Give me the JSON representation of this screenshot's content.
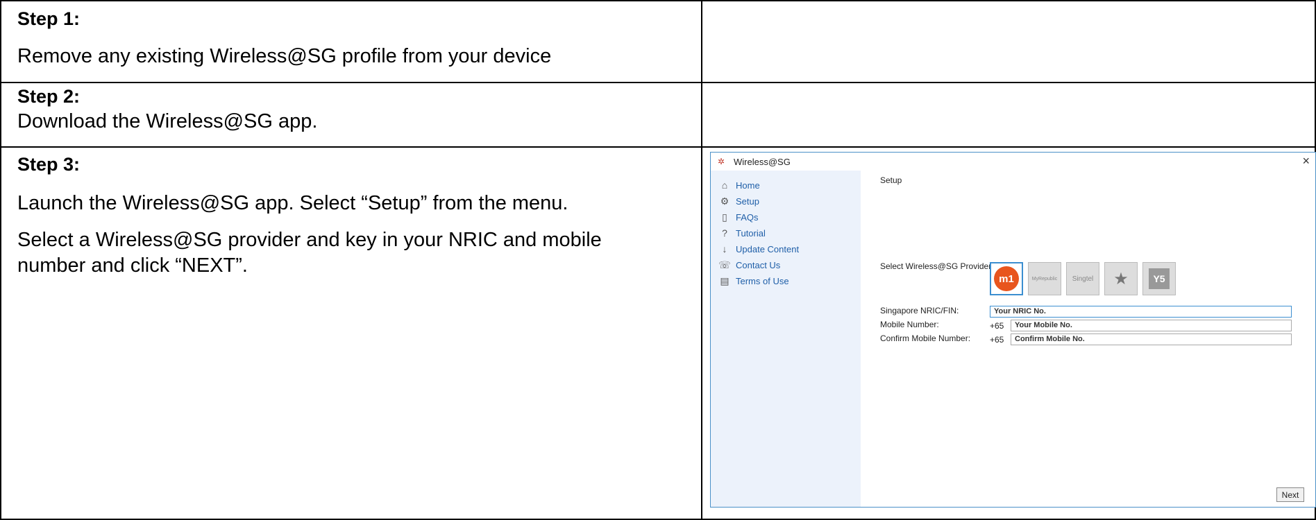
{
  "steps": [
    {
      "title": "Step 1:",
      "lines": [
        "Remove any existing Wireless@SG profile from your device"
      ]
    },
    {
      "title": "Step 2:",
      "lines": [
        "Download the Wireless@SG app."
      ]
    },
    {
      "title": "Step 3:",
      "lines": [
        "Launch the Wireless@SG app. Select “Setup” from the menu.",
        "Select a Wireless@SG provider and key in your NRIC and mobile",
        "number and click “NEXT”."
      ]
    }
  ],
  "app": {
    "window_title": "Wireless@SG",
    "close_glyph": "×",
    "nav": [
      {
        "label": "Home",
        "icon": "home-icon",
        "glyph": "⌂"
      },
      {
        "label": "Setup",
        "icon": "setup-icon",
        "glyph": "⚙"
      },
      {
        "label": "FAQs",
        "icon": "faqs-icon",
        "glyph": "▯"
      },
      {
        "label": "Tutorial",
        "icon": "tutorial-icon",
        "glyph": "?"
      },
      {
        "label": "Update Content",
        "icon": "update-icon",
        "glyph": "↓"
      },
      {
        "label": "Contact Us",
        "icon": "phone-icon",
        "glyph": "☏"
      },
      {
        "label": "Terms of Use",
        "icon": "document-icon",
        "glyph": "▤"
      }
    ],
    "page_heading": "Setup",
    "provider_label": "Select Wireless@SG Provider:",
    "providers": [
      {
        "name": "M1",
        "glyph": "m1",
        "selected": true
      },
      {
        "name": "MyRepublic",
        "glyph": "MyRepublic",
        "selected": false
      },
      {
        "name": "Singtel",
        "glyph": "Singtel",
        "selected": false
      },
      {
        "name": "StarHub",
        "glyph": "★",
        "selected": false
      },
      {
        "name": "Y5",
        "glyph": "Y5",
        "selected": false
      }
    ],
    "nric_label": "Singapore NRIC/FIN:",
    "nric_value": "Your NRIC No.",
    "mobile_label": "Mobile Number:",
    "mobile_prefix": "+65",
    "mobile_value": "Your Mobile No.",
    "confirm_label": "Confirm Mobile Number:",
    "confirm_prefix": "+65",
    "confirm_value": "Confirm Mobile No.",
    "next_label": "Next"
  },
  "colors": {
    "accent": "#1f5fa8",
    "sidebar": "#ecf2fb",
    "m1_orange": "#e8551e"
  }
}
